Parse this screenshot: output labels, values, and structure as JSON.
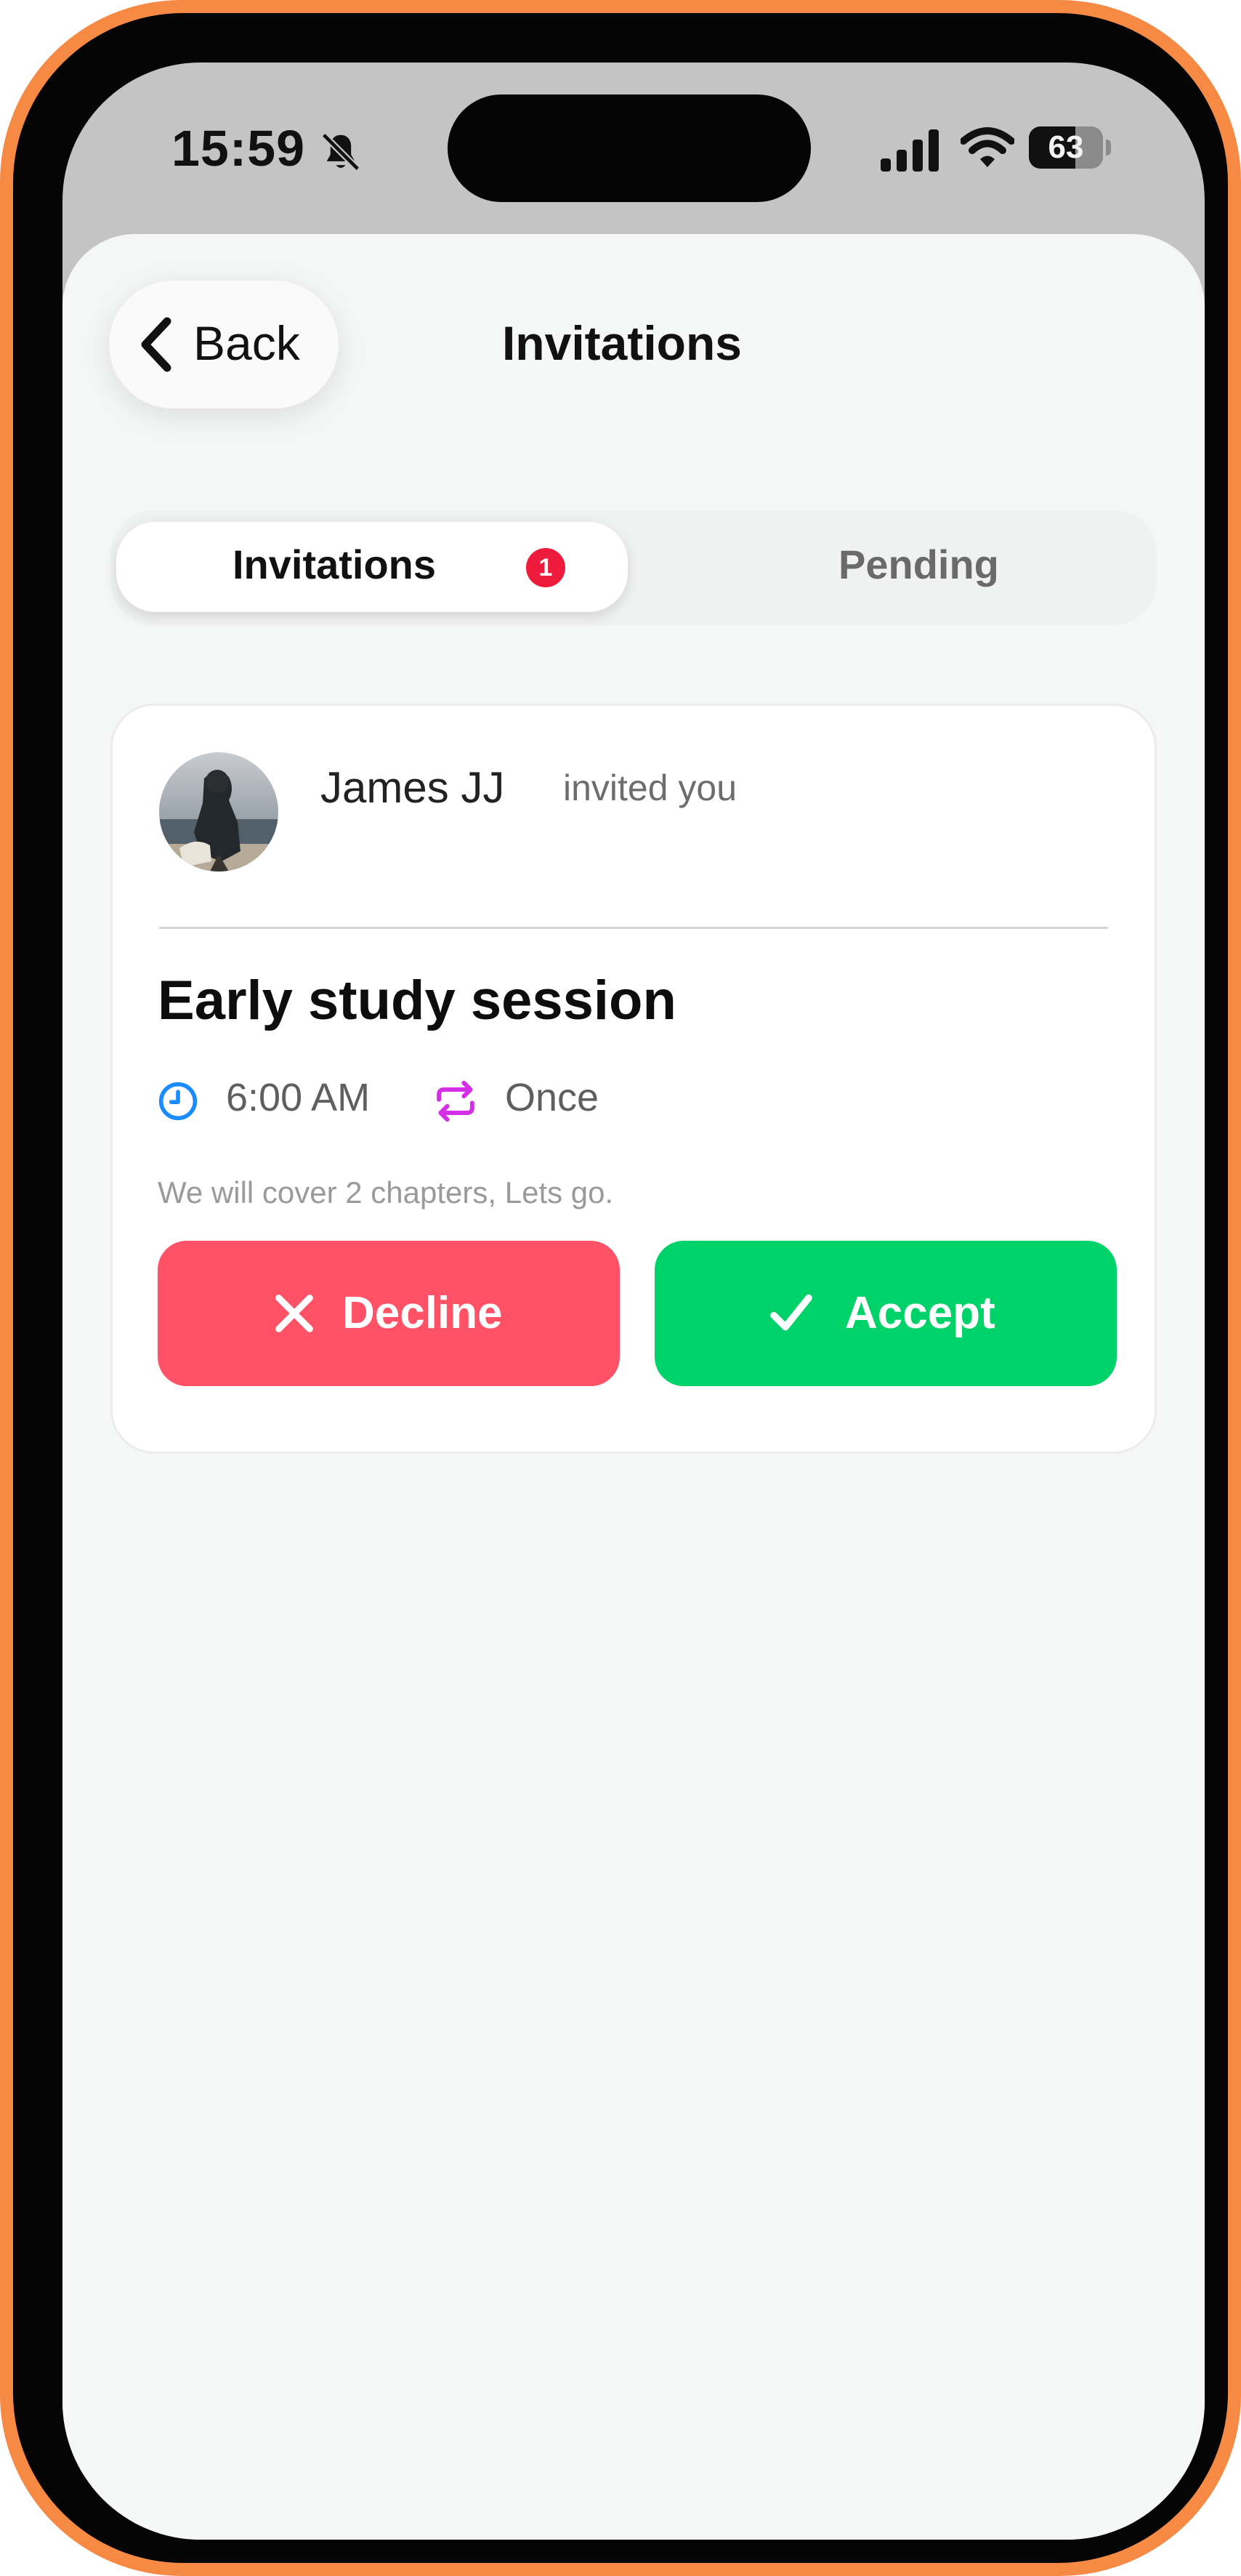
{
  "status_bar": {
    "time": "15:59",
    "battery": "63",
    "battery_level": 0.63,
    "icons": [
      "bell-slash-icon",
      "cellular-signal-icon",
      "wifi-icon",
      "battery-icon"
    ]
  },
  "nav": {
    "back_label": "Back",
    "title": "Invitations"
  },
  "tabs": [
    {
      "label": "Invitations",
      "badge": "1",
      "selected": true
    },
    {
      "label": "Pending",
      "selected": false
    }
  ],
  "invitation": {
    "inviter": "James JJ",
    "action_text": "invited you",
    "title": "Early study session",
    "time": "6:00 AM",
    "recurrence": "Once",
    "description": "We will cover 2 chapters, Lets go.",
    "decline_label": "Decline",
    "accept_label": "Accept"
  },
  "colors": {
    "frame": "#f68a45",
    "badge": "#ef1b3c",
    "clock_icon": "#1a8cff",
    "repeat_icon": "#d42ee6",
    "decline": "#ff5266",
    "accept": "#00d26a"
  }
}
